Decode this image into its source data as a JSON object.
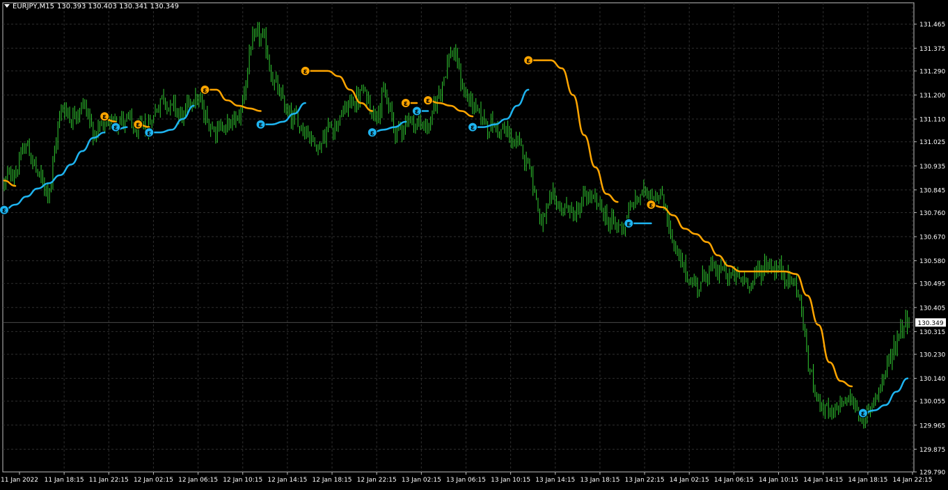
{
  "header": {
    "symbol_tf": "EURJPY,M15",
    "ohlc": "130.393 130.403 130.341 130.349"
  },
  "current_price": "130.349",
  "colors": {
    "background": "#000000",
    "candles": "#32cd32",
    "grid": "#2f2f2f",
    "axis": "#ffffff",
    "upper_line": "#ffa500",
    "lower_line": "#1eb4f0",
    "price_tag_bg": "#ffffff",
    "price_tag_text": "#000000"
  },
  "icons": {
    "upper_marker": "epsilon-circle-orange-icon",
    "lower_marker": "epsilon-circle-blue-icon",
    "marker_glyph": "ε"
  },
  "chart_data": {
    "type": "line",
    "title": "EURJPY,M15",
    "ylim": [
      129.79,
      131.545
    ],
    "grid": true,
    "y_ticks": [
      "131.465",
      "131.375",
      "131.290",
      "131.200",
      "131.110",
      "131.025",
      "130.935",
      "130.845",
      "130.760",
      "130.670",
      "130.580",
      "130.495",
      "130.405",
      "130.315",
      "130.230",
      "130.140",
      "130.055",
      "129.965",
      "129.875",
      "129.790"
    ],
    "x_ticks": [
      "11 Jan 2022",
      "11 Jan 18:15",
      "11 Jan 22:15",
      "12 Jan 02:15",
      "12 Jan 06:15",
      "12 Jan 10:15",
      "12 Jan 14:15",
      "12 Jan 18:15",
      "12 Jan 22:15",
      "13 Jan 02:15",
      "13 Jan 06:15",
      "13 Jan 10:15",
      "13 Jan 14:15",
      "13 Jan 18:15",
      "13 Jan 22:15",
      "14 Jan 02:15",
      "14 Jan 06:15",
      "14 Jan 10:15",
      "14 Jan 14:15",
      "14 Jan 18:15",
      "14 Jan 22:15"
    ],
    "price_path": [
      [
        0,
        130.87
      ],
      [
        1,
        130.93
      ],
      [
        2,
        131.02
      ],
      [
        3,
        130.88
      ],
      [
        4,
        130.84
      ],
      [
        5,
        131.17
      ],
      [
        6,
        131.12
      ],
      [
        7,
        131.18
      ],
      [
        8,
        131.05
      ],
      [
        9,
        131.07
      ],
      [
        10,
        131.13
      ],
      [
        11,
        131.09
      ],
      [
        12,
        131.05
      ],
      [
        13,
        131.1
      ],
      [
        14,
        131.2
      ],
      [
        15,
        131.16
      ],
      [
        16,
        131.11
      ],
      [
        17,
        131.22
      ],
      [
        18,
        131.1
      ],
      [
        19,
        131.09
      ],
      [
        20,
        131.08
      ],
      [
        21,
        131.12
      ],
      [
        22,
        131.39
      ],
      [
        23,
        131.42
      ],
      [
        24,
        131.25
      ],
      [
        25,
        131.15
      ],
      [
        26,
        131.1
      ],
      [
        27,
        131.08
      ],
      [
        28,
        131.0
      ],
      [
        29,
        131.08
      ],
      [
        30,
        131.12
      ],
      [
        31,
        131.17
      ],
      [
        32,
        131.21
      ],
      [
        33,
        131.14
      ],
      [
        34,
        131.2
      ],
      [
        35,
        131.05
      ],
      [
        36,
        131.12
      ],
      [
        37,
        131.09
      ],
      [
        38,
        131.08
      ],
      [
        39,
        131.24
      ],
      [
        40,
        131.38
      ],
      [
        41,
        131.22
      ],
      [
        42,
        131.15
      ],
      [
        43,
        131.1
      ],
      [
        44,
        131.08
      ],
      [
        45,
        131.05
      ],
      [
        46,
        131.0
      ],
      [
        47,
        130.95
      ],
      [
        48,
        130.7
      ],
      [
        49,
        130.8
      ],
      [
        50,
        130.78
      ],
      [
        51,
        130.75
      ],
      [
        52,
        130.82
      ],
      [
        53,
        130.79
      ],
      [
        54,
        130.73
      ],
      [
        55,
        130.7
      ],
      [
        56,
        130.78
      ],
      [
        57,
        130.83
      ],
      [
        58,
        130.85
      ],
      [
        59,
        130.8
      ],
      [
        60,
        130.6
      ],
      [
        61,
        130.52
      ],
      [
        62,
        130.49
      ],
      [
        63,
        130.55
      ],
      [
        64,
        130.54
      ],
      [
        65,
        130.52
      ],
      [
        66,
        130.5
      ],
      [
        67,
        130.51
      ],
      [
        68,
        130.57
      ],
      [
        69,
        130.55
      ],
      [
        70,
        130.52
      ],
      [
        71,
        130.48
      ],
      [
        72,
        130.15
      ],
      [
        73,
        130.05
      ],
      [
        74,
        129.97
      ],
      [
        75,
        130.07
      ],
      [
        76,
        130.05
      ],
      [
        77,
        129.96
      ],
      [
        78,
        130.1
      ],
      [
        79,
        130.17
      ],
      [
        80,
        130.32
      ],
      [
        81,
        130.39
      ]
    ],
    "series": [
      {
        "name": "Upper",
        "color": "#ffa500",
        "segments": [
          {
            "x0": 0,
            "pts": [
              [
                0,
                130.88
              ],
              [
                1,
                130.86
              ]
            ]
          },
          {
            "x0": 9,
            "pts": [
              [
                9,
                131.11
              ],
              [
                10,
                131.1
              ]
            ]
          },
          {
            "x0": 12,
            "pts": [
              [
                12,
                131.09
              ],
              [
                13,
                131.08
              ]
            ]
          },
          {
            "x0": 18,
            "pts": [
              [
                18,
                131.22
              ],
              [
                19,
                131.22
              ],
              [
                20,
                131.18
              ],
              [
                21,
                131.16
              ],
              [
                22,
                131.15
              ],
              [
                23,
                131.14
              ]
            ]
          },
          {
            "x0": 27,
            "pts": [
              [
                27,
                131.29
              ],
              [
                28,
                131.29
              ],
              [
                29,
                131.29
              ],
              [
                30,
                131.27
              ],
              [
                31,
                131.22
              ],
              [
                32,
                131.17
              ],
              [
                33,
                131.14
              ]
            ]
          },
          {
            "x0": 36,
            "pts": [
              [
                36,
                131.17
              ],
              [
                37,
                131.17
              ]
            ]
          },
          {
            "x0": 38,
            "pts": [
              [
                38,
                131.18
              ],
              [
                39,
                131.17
              ],
              [
                40,
                131.16
              ],
              [
                41,
                131.14
              ],
              [
                42,
                131.12
              ]
            ]
          },
          {
            "x0": 47,
            "pts": [
              [
                47,
                131.33
              ],
              [
                48,
                131.33
              ],
              [
                49,
                131.33
              ],
              [
                50,
                131.3
              ],
              [
                51,
                131.2
              ],
              [
                52,
                131.05
              ],
              [
                53,
                130.93
              ],
              [
                54,
                130.83
              ],
              [
                55,
                130.8
              ]
            ]
          },
          {
            "x0": 58,
            "pts": [
              [
                58,
                130.79
              ],
              [
                59,
                130.78
              ],
              [
                60,
                130.75
              ],
              [
                61,
                130.7
              ],
              [
                62,
                130.68
              ],
              [
                63,
                130.65
              ],
              [
                64,
                130.6
              ],
              [
                65,
                130.56
              ],
              [
                66,
                130.54
              ],
              [
                67,
                130.54
              ],
              [
                68,
                130.54
              ],
              [
                69,
                130.54
              ],
              [
                70,
                130.54
              ],
              [
                71,
                130.53
              ],
              [
                72,
                130.45
              ],
              [
                73,
                130.34
              ],
              [
                74,
                130.2
              ],
              [
                75,
                130.13
              ],
              [
                76,
                130.11
              ]
            ]
          }
        ]
      },
      {
        "name": "Lower",
        "color": "#1eb4f0",
        "segments": [
          {
            "x0": 0,
            "pts": [
              [
                0,
                130.77
              ],
              [
                1,
                130.79
              ],
              [
                2,
                130.82
              ],
              [
                3,
                130.85
              ],
              [
                4,
                130.87
              ],
              [
                5,
                130.9
              ],
              [
                6,
                130.94
              ],
              [
                7,
                130.99
              ],
              [
                8,
                131.04
              ],
              [
                9,
                131.06
              ]
            ]
          },
          {
            "x0": 10,
            "pts": [
              [
                10,
                131.07
              ],
              [
                11,
                131.08
              ]
            ]
          },
          {
            "x0": 13,
            "pts": [
              [
                13,
                131.06
              ],
              [
                14,
                131.06
              ],
              [
                15,
                131.07
              ],
              [
                16,
                131.11
              ],
              [
                17,
                131.16
              ]
            ]
          },
          {
            "x0": 23,
            "pts": [
              [
                23,
                131.09
              ],
              [
                24,
                131.09
              ],
              [
                25,
                131.1
              ],
              [
                26,
                131.13
              ],
              [
                27,
                131.17
              ]
            ]
          },
          {
            "x0": 33,
            "pts": [
              [
                33,
                131.06
              ],
              [
                34,
                131.07
              ],
              [
                35,
                131.08
              ],
              [
                36,
                131.1
              ]
            ]
          },
          {
            "x0": 37,
            "pts": [
              [
                37,
                131.14
              ],
              [
                38,
                131.14
              ]
            ]
          },
          {
            "x0": 42,
            "pts": [
              [
                42,
                131.08
              ],
              [
                43,
                131.08
              ],
              [
                44,
                131.09
              ],
              [
                45,
                131.11
              ],
              [
                46,
                131.16
              ],
              [
                47,
                131.22
              ]
            ]
          },
          {
            "x0": 56,
            "pts": [
              [
                56,
                130.72
              ],
              [
                57,
                130.72
              ],
              [
                58,
                130.72
              ]
            ]
          },
          {
            "x0": 77,
            "pts": [
              [
                77,
                130.01
              ],
              [
                78,
                130.02
              ],
              [
                79,
                130.04
              ],
              [
                80,
                130.09
              ],
              [
                81,
                130.14
              ]
            ]
          }
        ]
      }
    ],
    "markers": [
      {
        "series": "Upper",
        "x": 9,
        "y": 131.12
      },
      {
        "series": "Upper",
        "x": 12,
        "y": 131.09
      },
      {
        "series": "Upper",
        "x": 18,
        "y": 131.22
      },
      {
        "series": "Upper",
        "x": 27,
        "y": 131.29
      },
      {
        "series": "Upper",
        "x": 36,
        "y": 131.17
      },
      {
        "series": "Upper",
        "x": 38,
        "y": 131.18
      },
      {
        "series": "Upper",
        "x": 47,
        "y": 131.33
      },
      {
        "series": "Upper",
        "x": 58,
        "y": 130.79
      },
      {
        "series": "Lower",
        "x": 0,
        "y": 130.77
      },
      {
        "series": "Lower",
        "x": 10,
        "y": 131.08
      },
      {
        "series": "Lower",
        "x": 13,
        "y": 131.06
      },
      {
        "series": "Lower",
        "x": 23,
        "y": 131.09
      },
      {
        "series": "Lower",
        "x": 33,
        "y": 131.06
      },
      {
        "series": "Lower",
        "x": 37,
        "y": 131.14
      },
      {
        "series": "Lower",
        "x": 42,
        "y": 131.08
      },
      {
        "series": "Lower",
        "x": 56,
        "y": 130.72
      },
      {
        "series": "Lower",
        "x": 77,
        "y": 130.01
      }
    ]
  }
}
